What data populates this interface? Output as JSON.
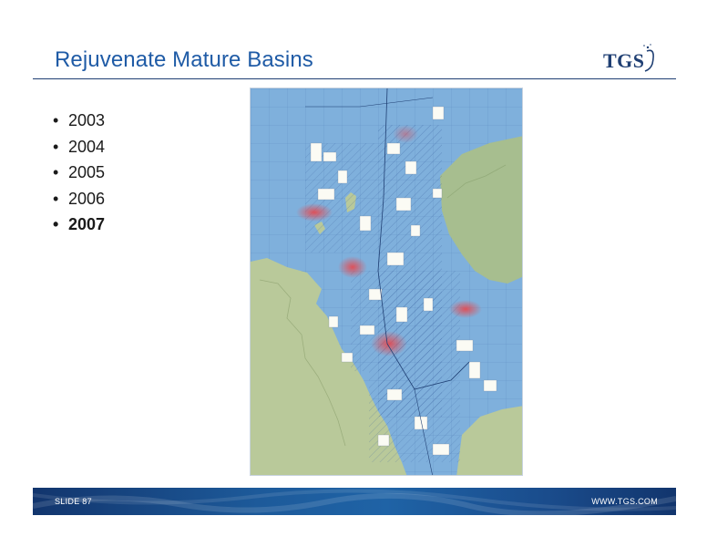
{
  "slide": {
    "title": "Rejuvenate Mature Basins",
    "logo": {
      "text": "TGS",
      "icon": "tgs-swoosh-icon"
    },
    "bullets": [
      {
        "text": "2003",
        "bold": false
      },
      {
        "text": "2004",
        "bold": false
      },
      {
        "text": "2005",
        "bold": false
      },
      {
        "text": "2006",
        "bold": false
      },
      {
        "text": "2007",
        "bold": true
      }
    ],
    "map": {
      "icon": "north-sea-seismic-coverage-map"
    },
    "footer": {
      "left": "SLIDE 87",
      "right": "WWW.TGS.COM"
    },
    "colors": {
      "title": "#1f5ba6",
      "rule": "#1f3f73",
      "footer": "#1d5a9a",
      "sea": "#7fb0dc",
      "land": "#b9c99a",
      "highlight": "#e8474c"
    }
  }
}
